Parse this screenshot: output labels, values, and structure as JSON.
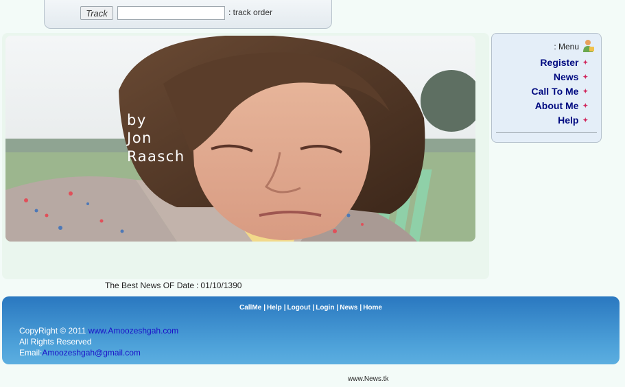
{
  "track": {
    "button_label": "Track",
    "input_value": "",
    "label": ": track order"
  },
  "banner": {
    "caption_lines": [
      "by",
      "Jon",
      "Raasch"
    ]
  },
  "news_date": {
    "label": "The Best News OF Date",
    "sep": ":",
    "date": "01/10/1390"
  },
  "menu": {
    "title": ": Menu",
    "items": [
      {
        "label": "Register"
      },
      {
        "label": "News"
      },
      {
        "label": "Call To Me"
      },
      {
        "label": "About Me"
      },
      {
        "label": "Help"
      }
    ]
  },
  "footer": {
    "links": [
      "CallMe",
      "Help",
      "Logout",
      "Login",
      "News",
      "Home"
    ],
    "link_sep": "|",
    "copyright_text": "CopyRight © 2011",
    "site_link": "www.Amoozeshgah.com",
    "rights": "All Rights Reserved",
    "email_label": "Email:",
    "email": "Amoozeshgah@gmail.com"
  },
  "bottom_link": "www.News.tk",
  "colors": {
    "menu_link": "#000a80",
    "footer_link": "#1a10c8",
    "footer_bg": "#2a78c0"
  }
}
